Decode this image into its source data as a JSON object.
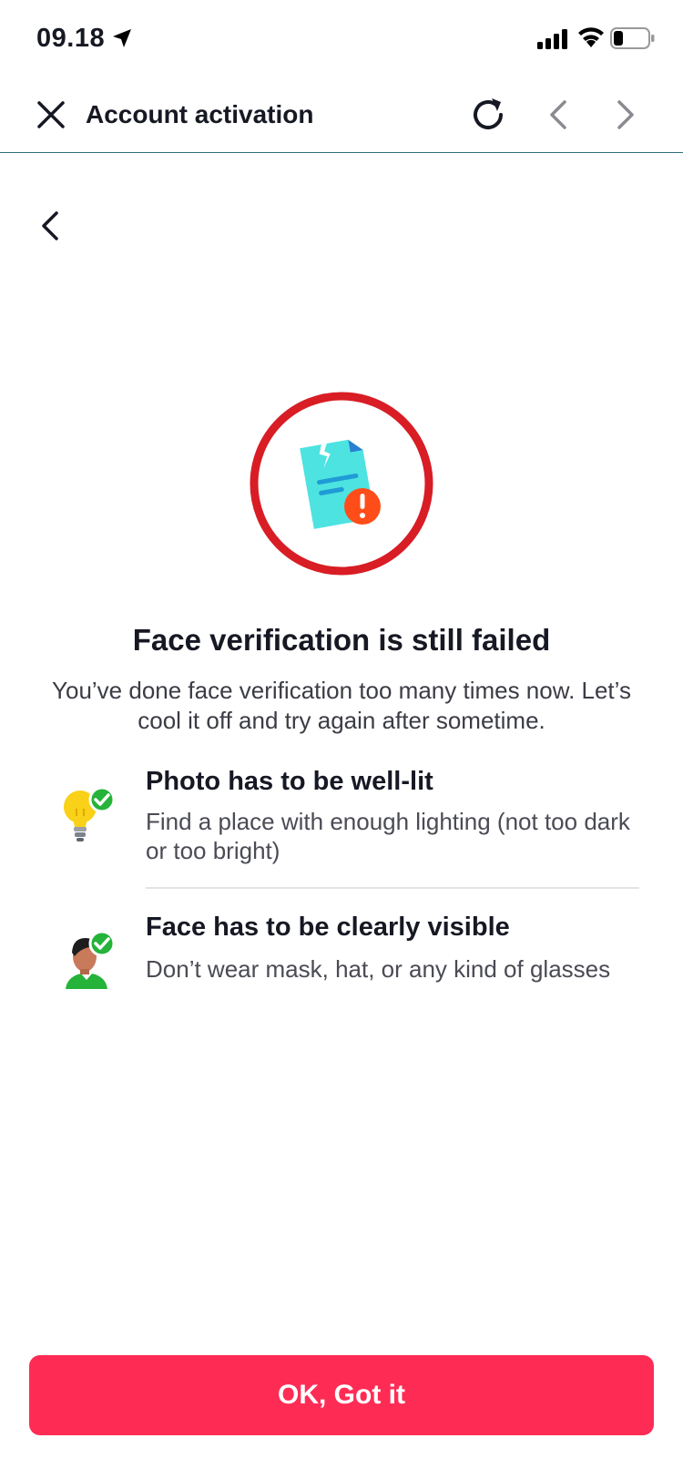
{
  "status_bar": {
    "time": "09.18",
    "icons": [
      "location-arrow-icon",
      "signal-icon",
      "wifi-icon",
      "battery-icon"
    ]
  },
  "nav": {
    "title": "Account activation",
    "icons": [
      "close-icon",
      "refresh-icon",
      "chevron-left-icon",
      "chevron-right-icon"
    ]
  },
  "page": {
    "back_icon": "chevron-left-icon",
    "hero_icon": "broken-document-error-icon",
    "headline": "Face verification is still failed",
    "subtext": "You’ve done face verification too many times now. Let’s cool it off and try again after sometime."
  },
  "tips": [
    {
      "icon": "lightbulb-check-icon",
      "title": "Photo has to be well-lit",
      "desc": "Find a place with enough lighting (not too dark or too bright)"
    },
    {
      "icon": "face-check-icon",
      "title": "Face has to be clearly visible",
      "desc": "Don’t wear mask, hat, or any kind of glasses"
    }
  ],
  "button": {
    "label": "OK, Got it"
  },
  "colors": {
    "accent": "#fe2c55",
    "error_ring": "#d81d25",
    "document": "#4de3e0",
    "check_green": "#25b33a",
    "bulb_yellow": "#f8d118"
  }
}
